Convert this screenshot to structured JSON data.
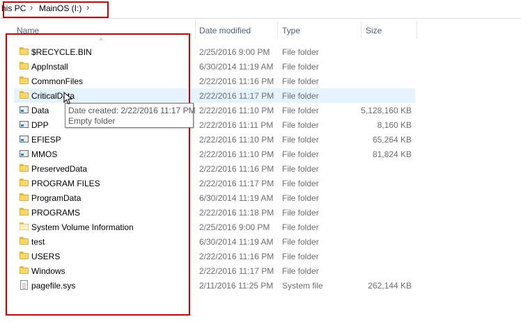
{
  "breadcrumb": {
    "items": [
      "his PC",
      "MainOS (I:)"
    ],
    "more_label": "›"
  },
  "columns": {
    "name": "Name",
    "date": "Date modified",
    "type": "Type",
    "size": "Size"
  },
  "files": [
    {
      "name": "$RECYCLE.BIN",
      "date": "2/25/2016 9:00 PM",
      "type": "File folder",
      "size": "",
      "icon": "folder-icon"
    },
    {
      "name": "AppInstall",
      "date": "6/30/2014 11:19 AM",
      "type": "File folder",
      "size": "",
      "icon": "folder-icon"
    },
    {
      "name": "CommonFiles",
      "date": "2/22/2016 11:16 PM",
      "type": "File folder",
      "size": "",
      "icon": "folder-icon"
    },
    {
      "name": "CriticalData",
      "date": "2/22/2016 11:17 PM",
      "type": "File folder",
      "size": "",
      "icon": "folder-icon",
      "hovered": true
    },
    {
      "name": "Data",
      "date": "2/22/2016 11:10 PM",
      "type": "File folder",
      "size": "5,128,160 KB",
      "icon": "drive-icon"
    },
    {
      "name": "DPP",
      "date": "2/22/2016 11:11 PM",
      "type": "File folder",
      "size": "8,160 KB",
      "icon": "drive-icon"
    },
    {
      "name": "EFIESP",
      "date": "2/22/2016 11:10 PM",
      "type": "File folder",
      "size": "65,264 KB",
      "icon": "drive-icon"
    },
    {
      "name": "MMOS",
      "date": "2/22/2016 11:10 PM",
      "type": "File folder",
      "size": "81,824 KB",
      "icon": "drive-icon"
    },
    {
      "name": "PreservedData",
      "date": "2/22/2016 11:16 PM",
      "type": "File folder",
      "size": "",
      "icon": "folder-icon"
    },
    {
      "name": "PROGRAM FILES",
      "date": "2/22/2016 11:17 PM",
      "type": "File folder",
      "size": "",
      "icon": "folder-icon"
    },
    {
      "name": "ProgramData",
      "date": "6/30/2014 11:19 AM",
      "type": "File folder",
      "size": "",
      "icon": "folder-icon"
    },
    {
      "name": "PROGRAMS",
      "date": "2/22/2016 11:18 PM",
      "type": "File folder",
      "size": "",
      "icon": "folder-icon"
    },
    {
      "name": "System Volume Information",
      "date": "2/25/2016 9:00 PM",
      "type": "File folder",
      "size": "",
      "icon": "system-folder-icon"
    },
    {
      "name": "test",
      "date": "6/30/2014 11:19 AM",
      "type": "File folder",
      "size": "",
      "icon": "folder-icon"
    },
    {
      "name": "USERS",
      "date": "2/22/2016 11:16 PM",
      "type": "File folder",
      "size": "",
      "icon": "folder-icon"
    },
    {
      "name": "Windows",
      "date": "2/22/2016 11:17 PM",
      "type": "File folder",
      "size": "",
      "icon": "folder-icon"
    },
    {
      "name": "pagefile.sys",
      "date": "2/11/2016 11:25 PM",
      "type": "System file",
      "size": "262,144 KB",
      "icon": "file-icon"
    }
  ],
  "tooltip": {
    "line1": "Date created: 2/22/2016 11:17 PM",
    "line2": "Empty folder"
  },
  "colors": {
    "hover_row": "#e5f3ff",
    "annotation_box": "#d40000",
    "folder": "#ffd766",
    "header_text": "#4c607a"
  }
}
